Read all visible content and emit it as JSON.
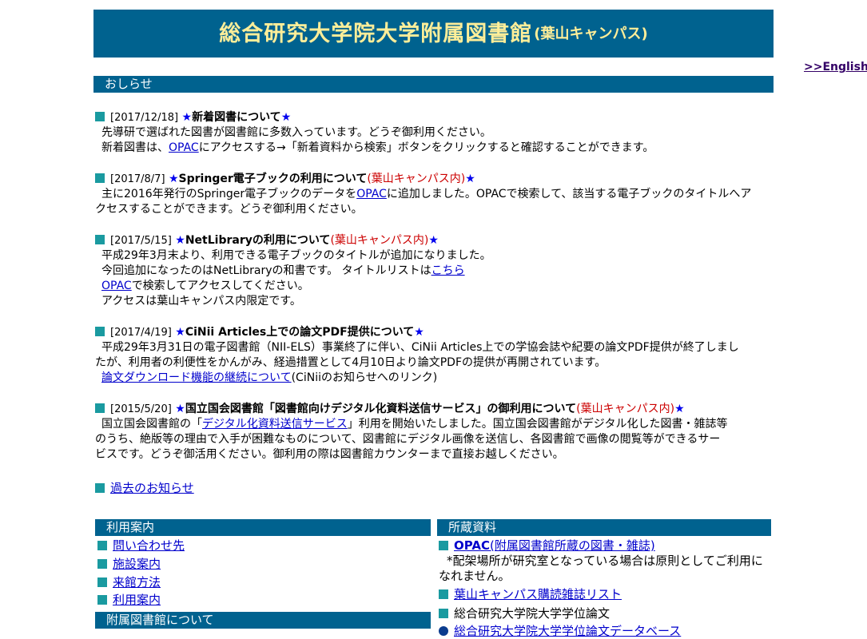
{
  "header": {
    "title": "総合研究大学院大学附属図書館",
    "subtitle": "(葉山キャンパス)",
    "english_link": ">>English"
  },
  "sections": {
    "news": "おしらせ",
    "usage": "利用案内",
    "holdings": "所蔵資料",
    "about": "附属図書館について"
  },
  "news": [
    {
      "date": "[2017/12/18]",
      "star1": "★",
      "title": "新着図書について",
      "star2": "★",
      "line1": "先導研で選ばれた図書が図書館に多数入っています。どうぞ御利用ください。",
      "line2_pre": "新着図書は、",
      "line2_link": "OPAC",
      "line2_post": "にアクセスする→「新着資料から検索」ボタンをクリックすると確認することができます。"
    },
    {
      "date": "[2017/8/7]",
      "star1": "★",
      "title": "Springer電子ブックの利用について",
      "note": "(葉山キャンパス内)",
      "star2": "★",
      "line1_pre": "主に2016年発行のSpringer電子ブックのデータを",
      "line1_link": "OPAC",
      "line1_post": "に追加しました。OPACで検索して、該当する電子ブックのタイトルへア",
      "line2": "クセスすることができます。どうぞ御利用ください。"
    },
    {
      "date": "[2017/5/15]",
      "star1": "★",
      "title": "NetLibraryの利用について",
      "note": "(葉山キャンパス内)",
      "star2": "★",
      "line1": "平成29年3月末より、利用できる電子ブックのタイトルが追加になりました。",
      "line2_pre": "今回追加になったのはNetLibraryの和書です。 タイトルリストは",
      "line2_link": "こちら",
      "line3_link": "OPAC",
      "line3_post": "で検索してアクセスしてください。",
      "line4": "アクセスは葉山キャンパス内限定です。"
    },
    {
      "date": "[2017/4/19]",
      "star1": "★",
      "title": "CiNii Articles上での論文PDF提供について",
      "star2": "★",
      "line1": "平成29年3月31日の電子図書館（NII-ELS）事業終了に伴い、CiNii Articles上での学協会誌や紀要の論文PDF提供が終了しまし",
      "line2": "たが、利用者の利便性をかんがみ、経過措置として4月10日より論文PDFの提供が再開されています。",
      "line3_link": "論文ダウンロード機能の継続について",
      "line3_post": "(CiNiiのお知らせへのリンク)"
    },
    {
      "date": "[2015/5/20]",
      "star1": "★",
      "title": "国立国会図書館「図書館向けデジタル化資料送信サービス」の御利用について",
      "note": "(葉山キャンパス内)",
      "star2": "★",
      "line1_pre": "国立国会図書館の「",
      "line1_link": "デジタル化資料送信サービス",
      "line1_post": "」利用を開始いたしました。国立国会図書館がデジタル化した図書・雑誌等",
      "line2": "のうち、絶版等の理由で入手が困難なものについて、図書館にデジタル画像を送信し、各図書館で画像の閲覧等ができるサー",
      "line3": "ビスです。どうぞ御活用ください。御利用の際は図書館カウンターまで直接お越しください。"
    }
  ],
  "past_news": "過去のお知らせ",
  "usage_links": [
    "問い合わせ先",
    "施設案内",
    "来館方法",
    "利用案内"
  ],
  "holdings": {
    "opac_link": "OPAC",
    "opac_desc": "(附属図書館所蔵の図書・雑誌)",
    "opac_note1": "*配架場所が研究室となっている場合は原則としてご利用に",
    "opac_note2": "なれません。",
    "journal_link": "葉山キャンパス購読雑誌リスト",
    "thesis": "総合研究大学院大学学位論文",
    "thesis_db": "総合研究大学院大学学位論文データベース"
  },
  "colors": {
    "bar": "#00628f",
    "title_text": "#ffee99",
    "square": "#1a9aa0",
    "star": "#0000ee",
    "note": "#cc0000"
  }
}
